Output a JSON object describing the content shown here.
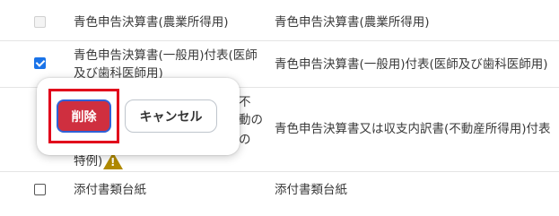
{
  "rows": [
    {
      "checkbox_state": "disabled",
      "col1": "青色申告決算書(農業所得用)",
      "col2": "青色申告決算書(農業所得用)"
    },
    {
      "checkbox_state": "checked",
      "col1": "青色申告決算書(一般用)付表(医師及び歯科医師用)",
      "col2": "青色申告決算書(一般用)付表(医師及び歯科医師用)"
    },
    {
      "col1_visible_fragments": [
        "不",
        "動の",
        "の",
        "特例)"
      ],
      "col2": "青色申告決算書又は収支内訳書(不動産所得用)付表",
      "warning_icon": "warning-triangle-icon"
    },
    {
      "checkbox_state": "unchecked",
      "col1": "添付書類台紙",
      "col2": "添付書類台紙"
    }
  ],
  "popover": {
    "delete_label": "削除",
    "cancel_label": "キャンセル"
  },
  "colors": {
    "delete_button": "#cf2f3f",
    "highlight_border": "#e1001b",
    "checkbox_checked": "#1a73e8",
    "warning": "#b08a00"
  }
}
